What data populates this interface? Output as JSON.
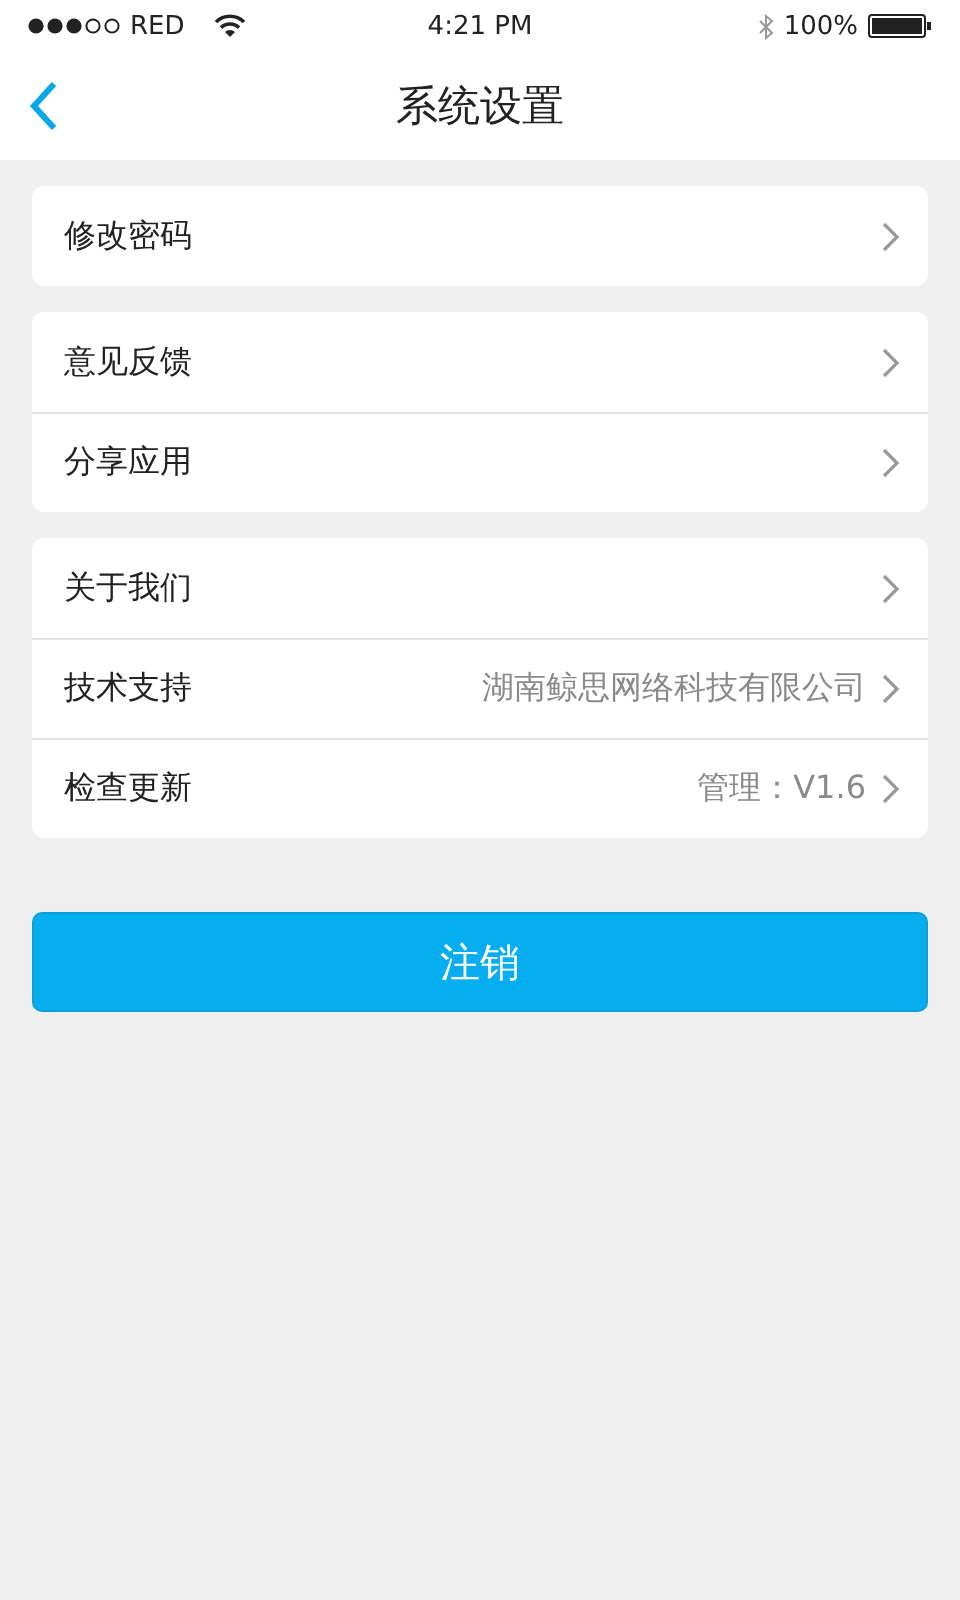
{
  "status_bar": {
    "carrier": "RED",
    "time": "4:21 PM",
    "battery": "100%"
  },
  "nav": {
    "title": "系统设置"
  },
  "groups": [
    {
      "items": [
        {
          "label": "修改密码"
        }
      ]
    },
    {
      "items": [
        {
          "label": "意见反馈"
        },
        {
          "label": "分享应用"
        }
      ]
    },
    {
      "items": [
        {
          "label": "关于我们"
        },
        {
          "label": "技术支持",
          "value": "湖南鲸思网络科技有限公司"
        },
        {
          "label": "检查更新",
          "value": "管理：V1.6"
        }
      ]
    }
  ],
  "logout_button": "注销"
}
